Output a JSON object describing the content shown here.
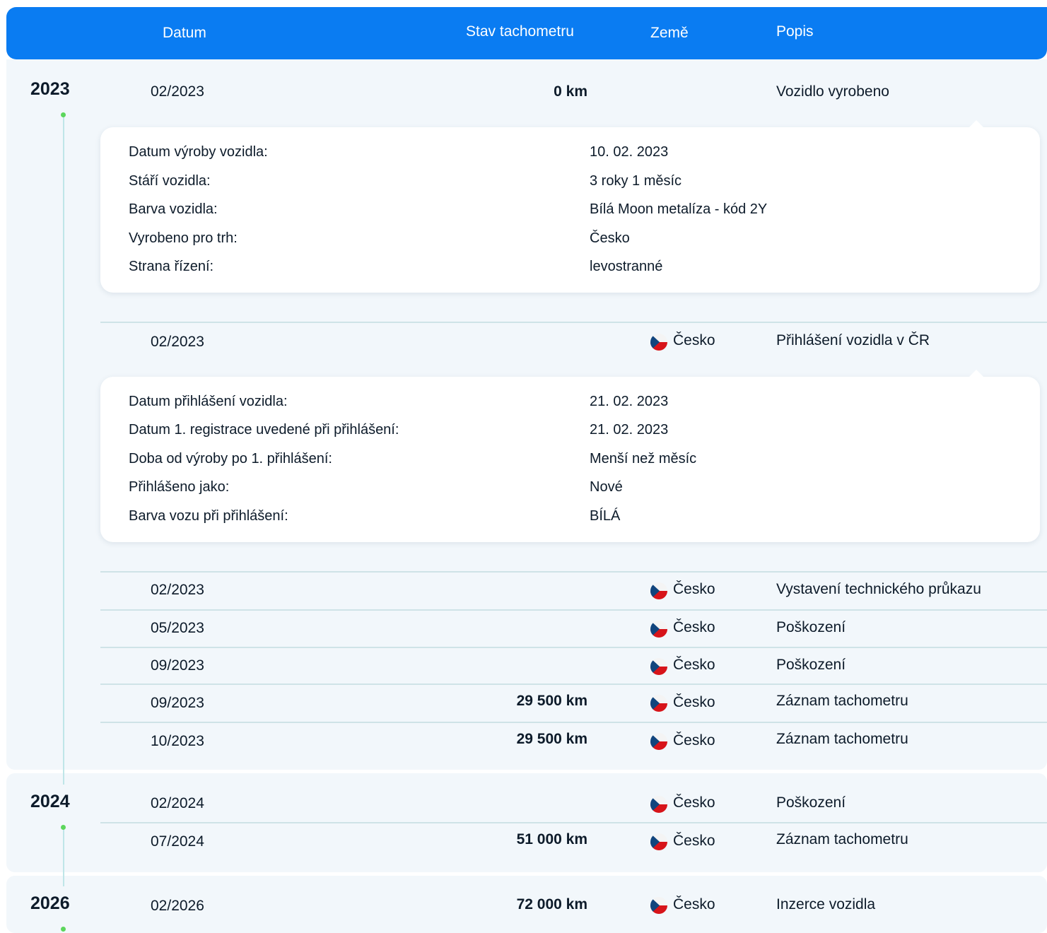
{
  "header": {
    "date": "Datum",
    "odometer": "Stav tachometru",
    "country": "Země",
    "description": "Popis"
  },
  "years": [
    "2023",
    "2024",
    "2026"
  ],
  "events": [
    {
      "date": "02/2023",
      "odometer": "0 km",
      "country": "",
      "description": "Vozidlo vyrobeno"
    },
    {
      "date": "02/2023",
      "odometer": "",
      "country": "Česko",
      "description": "Přihlášení vozidla v ČR"
    },
    {
      "date": "02/2023",
      "odometer": "",
      "country": "Česko",
      "description": "Vystavení technického průkazu"
    },
    {
      "date": "05/2023",
      "odometer": "",
      "country": "Česko",
      "description": "Poškození"
    },
    {
      "date": "09/2023",
      "odometer": "",
      "country": "Česko",
      "description": "Poškození"
    },
    {
      "date": "09/2023",
      "odometer": "29 500 km",
      "country": "Česko",
      "description": "Záznam tachometru"
    },
    {
      "date": "10/2023",
      "odometer": "29 500 km",
      "country": "Česko",
      "description": "Záznam tachometru"
    },
    {
      "date": "02/2024",
      "odometer": "",
      "country": "Česko",
      "description": "Poškození"
    },
    {
      "date": "07/2024",
      "odometer": "51 000 km",
      "country": "Česko",
      "description": "Záznam tachometru"
    },
    {
      "date": "02/2026",
      "odometer": "72 000 km",
      "country": "Česko",
      "description": "Inzerce vozidla"
    }
  ],
  "production_details": [
    {
      "label": "Datum výroby vozidla:",
      "value": "10. 02. 2023"
    },
    {
      "label": "Stáří vozidla:",
      "value": "3 roky 1 měsíc"
    },
    {
      "label": "Barva vozidla:",
      "value": "Bílá Moon metalíza - kód 2Y"
    },
    {
      "label": "Vyrobeno pro trh:",
      "value": "Česko"
    },
    {
      "label": "Strana řízení:",
      "value": "levostranné"
    }
  ],
  "registration_details": [
    {
      "label": "Datum přihlášení vozidla:",
      "value": "21. 02. 2023"
    },
    {
      "label": "Datum 1. registrace uvedené při přihlášení:",
      "value": "21. 02. 2023"
    },
    {
      "label": "Doba od výroby po 1. přihlášení:",
      "value": "Menší než měsíc"
    },
    {
      "label": "Přihlášeno jako:",
      "value": "Nové"
    },
    {
      "label": "Barva vozu při přihlášení:",
      "value": "BÍLÁ"
    }
  ],
  "colors": {
    "header_bg": "#0a7cf2",
    "section_bg": "#f2f7fb",
    "timeline_dot": "#5cd65c"
  }
}
